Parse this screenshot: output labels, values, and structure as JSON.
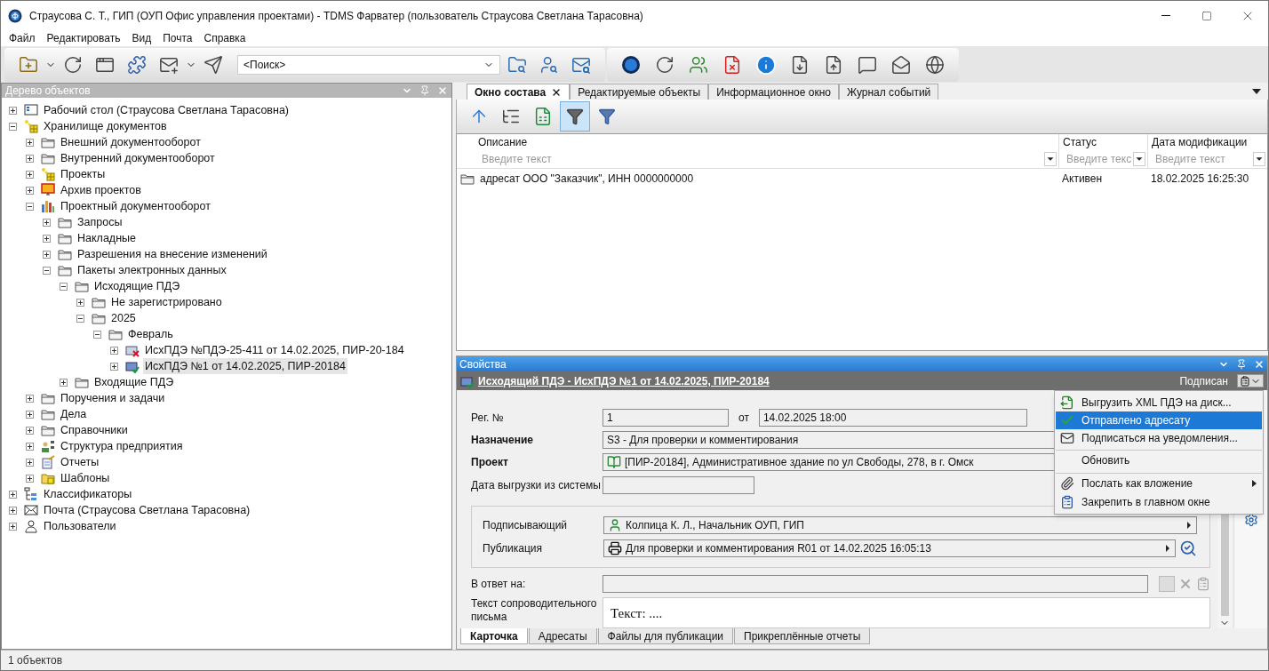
{
  "window": {
    "title": "Страусова С. Т., ГИП (ОУП Офис управления проектами) - TDMS Фарватер (пользователь Страусова Светлана Тарасовна)"
  },
  "menu": [
    "Файл",
    "Редактировать",
    "Вид",
    "Почта",
    "Справка"
  ],
  "toolbar": {
    "search": {
      "value": "<Поиск>"
    }
  },
  "tree": {
    "title": "Дерево объектов",
    "items": [
      {
        "label": "Рабочий стол (Страусова Светлана Тарасовна)",
        "kind": "desktop",
        "expanded": false,
        "selected": false
      },
      {
        "label": "Хранилище документов",
        "kind": "storage",
        "expanded": true,
        "selected": false,
        "children": [
          {
            "label": "Внешний документооборот",
            "kind": "folder",
            "expanded": false,
            "selected": false
          },
          {
            "label": "Внутренний документооборот",
            "kind": "folder",
            "expanded": false,
            "selected": false
          },
          {
            "label": "Проекты",
            "kind": "storage",
            "expanded": false,
            "selected": false
          },
          {
            "label": "Архив проектов",
            "kind": "archive",
            "expanded": false,
            "selected": false
          },
          {
            "label": "Проектный документооборот",
            "kind": "chart",
            "expanded": true,
            "selected": false,
            "children": [
              {
                "label": "Запросы",
                "kind": "folder",
                "expanded": false,
                "selected": false
              },
              {
                "label": "Накладные",
                "kind": "folder",
                "expanded": false,
                "selected": false
              },
              {
                "label": "Разрешения на внесение изменений",
                "kind": "folder",
                "expanded": false,
                "selected": false
              },
              {
                "label": "Пакеты электронных данных",
                "kind": "folder",
                "expanded": true,
                "selected": false,
                "children": [
                  {
                    "label": "Исходящие ПДЭ",
                    "kind": "folder",
                    "expanded": true,
                    "selected": false,
                    "children": [
                      {
                        "label": "Не зарегистрировано",
                        "kind": "folder",
                        "expanded": false,
                        "selected": false
                      },
                      {
                        "label": "2025",
                        "kind": "folder",
                        "expanded": true,
                        "selected": false,
                        "children": [
                          {
                            "label": "Февраль",
                            "kind": "folder",
                            "expanded": true,
                            "selected": false,
                            "children": [
                              {
                                "label": "ИсхПДЭ №ПДЭ-25-411 от 14.02.2025, ПИР-20-184",
                                "kind": "doc-rejected",
                                "expanded": false,
                                "selected": false
                              },
                              {
                                "label": "ИсхПДЭ №1 от 14.02.2025, ПИР-20184",
                                "kind": "doc-signed",
                                "expanded": false,
                                "selected": true
                              }
                            ]
                          }
                        ]
                      }
                    ]
                  },
                  {
                    "label": "Входящие ПДЭ",
                    "kind": "folder",
                    "expanded": false,
                    "selected": false
                  }
                ]
              }
            ]
          },
          {
            "label": "Поручения и задачи",
            "kind": "folder",
            "expanded": false,
            "selected": false
          },
          {
            "label": "Дела",
            "kind": "folder",
            "expanded": false,
            "selected": false
          },
          {
            "label": "Справочники",
            "kind": "folder",
            "expanded": false,
            "selected": false
          },
          {
            "label": "Структура предприятия",
            "kind": "org",
            "expanded": false,
            "selected": false
          },
          {
            "label": "Отчеты",
            "kind": "report",
            "expanded": false,
            "selected": false
          },
          {
            "label": "Шаблоны",
            "kind": "templates",
            "expanded": false,
            "selected": false
          }
        ]
      },
      {
        "label": "Классификаторы",
        "kind": "classifier",
        "expanded": false,
        "selected": false
      },
      {
        "label": "Почта (Страусова Светлана Тарасовна)",
        "kind": "mail",
        "expanded": false,
        "selected": false
      },
      {
        "label": "Пользователи",
        "kind": "user",
        "expanded": false,
        "selected": false
      }
    ]
  },
  "tabs": [
    {
      "label": "Окно состава",
      "selected": true,
      "closable": true
    },
    {
      "label": "Редактируемые объекты",
      "selected": false,
      "closable": false
    },
    {
      "label": "Информационное окно",
      "selected": false,
      "closable": false
    },
    {
      "label": "Журнал событий",
      "selected": false,
      "closable": false
    }
  ],
  "table": {
    "columns": [
      {
        "label": "Описание",
        "filter_placeholder": "Введите текст"
      },
      {
        "label": "Статус",
        "filter_placeholder": "Введите текс"
      },
      {
        "label": "Дата модификации",
        "filter_placeholder": "Введите текст"
      }
    ],
    "rows": [
      {
        "kind": "folder",
        "cells": [
          "адресат ООО \"Заказчик\", ИНН 0000000000",
          "Активен",
          "18.02.2025 16:25:30"
        ]
      }
    ]
  },
  "properties": {
    "title": "Свойства",
    "object_title": "Исходящий ПДЭ - ИсхПДЭ №1 от 14.02.2025, ПИР-20184",
    "status": "Подписан",
    "reg": {
      "label": "Рег. №",
      "value": "1",
      "date_label": "от",
      "date_value": "14.02.2025 18:00"
    },
    "fields": [
      {
        "label": "Назначение",
        "bold": true,
        "kind": "text",
        "value": "S3 - Для проверки и комментирования"
      },
      {
        "label": "Проект",
        "bold": true,
        "kind": "project",
        "value": "[ПИР-20184], Административное здание по ул Свободы, 278, в г. Омск"
      },
      {
        "label": "Дата выгрузки из системы",
        "bold": false,
        "kind": "short"
      }
    ],
    "group_fields": [
      {
        "label": "Подписывающий",
        "kind": "person",
        "value": "Колпица К. Л., Начальник ОУП, ГИП"
      },
      {
        "label": "Публикация",
        "kind": "publication",
        "value": "Для проверки и комментирования R01 от 14.02.2025 16:05:13"
      }
    ],
    "reply": {
      "label": "В ответ на:"
    },
    "letter": {
      "label": "Текст сопроводительного письма",
      "value": "Текст: ...."
    },
    "tabs": [
      {
        "label": "Карточка",
        "selected": true
      },
      {
        "label": "Адресаты",
        "selected": false
      },
      {
        "label": "Файлы для публикации",
        "selected": false
      },
      {
        "label": "Прикреплённые отчеты",
        "selected": false
      }
    ]
  },
  "context_menu": {
    "items": [
      {
        "label": "Выгрузить XML ПДЭ на диск...",
        "kind": "export",
        "selected": false,
        "checked": false,
        "submenu": false,
        "separator_before": false
      },
      {
        "label": "Отправлено адресату",
        "kind": "sent",
        "selected": true,
        "checked": true,
        "submenu": false,
        "separator_before": false
      },
      {
        "label": "Подписаться на уведомления...",
        "kind": "subscribe",
        "selected": false,
        "checked": false,
        "submenu": false,
        "separator_before": false
      },
      {
        "label": "Обновить",
        "kind": "refresh",
        "selected": false,
        "checked": false,
        "submenu": false,
        "separator_before": true
      },
      {
        "label": "Послать как вложение",
        "kind": "attach",
        "selected": false,
        "checked": false,
        "submenu": true,
        "separator_before": true
      },
      {
        "label": "Закрепить в главном окне",
        "kind": "pin",
        "selected": false,
        "checked": false,
        "submenu": false,
        "separator_before": false
      }
    ]
  },
  "status_bar": "1 объектов"
}
